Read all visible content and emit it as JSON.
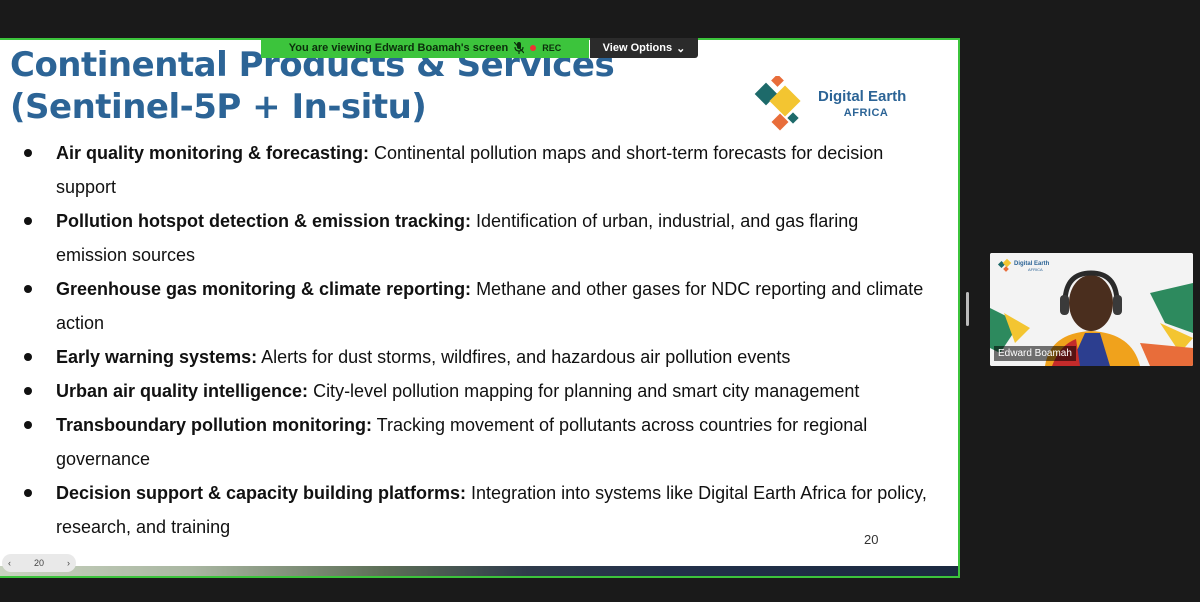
{
  "banner": {
    "viewing_text": "You are viewing  Edward Boamah's screen",
    "rec_label": "REC",
    "view_options_label": "View Options"
  },
  "slide": {
    "title_line1": "Continental Products & Services",
    "title_line2": "(Sentinel-5P + In-situ)",
    "logo": {
      "line1": "Digital Earth",
      "line2": "AFRICA"
    },
    "bullets": [
      {
        "bold": "Air quality monitoring & forecasting:",
        "text": " Continental pollution maps and short-term forecasts for decision support"
      },
      {
        "bold": "Pollution hotspot detection & emission tracking:",
        "text": " Identification of urban, industrial, and gas flaring emission sources"
      },
      {
        "bold": "Greenhouse gas monitoring & climate reporting:",
        "text": " Methane and other gases for NDC reporting and climate action"
      },
      {
        "bold": "Early warning systems:",
        "text": " Alerts for dust storms, wildfires, and hazardous air pollution events"
      },
      {
        "bold": "Urban air quality intelligence:",
        "text": " City-level pollution mapping for planning and smart city management"
      },
      {
        "bold": "Transboundary pollution monitoring:",
        "text": " Tracking movement of pollutants across countries for regional governance"
      },
      {
        "bold": "Decision support & capacity building platforms:",
        "text": " Integration into systems like Digital Earth Africa for policy, research, and training"
      }
    ],
    "page_number": "20"
  },
  "slide_nav": {
    "page": "20"
  },
  "video_tile": {
    "participant_name": "Edward Boamah",
    "logo_line1": "Digital Earth",
    "logo_line2": "AFRICA"
  },
  "colors": {
    "border_green": "#3cc43c",
    "title_blue": "#2c6496",
    "logo_teal": "#1d6a6a",
    "logo_yellow": "#f3c531",
    "logo_orange": "#e86d3a"
  }
}
